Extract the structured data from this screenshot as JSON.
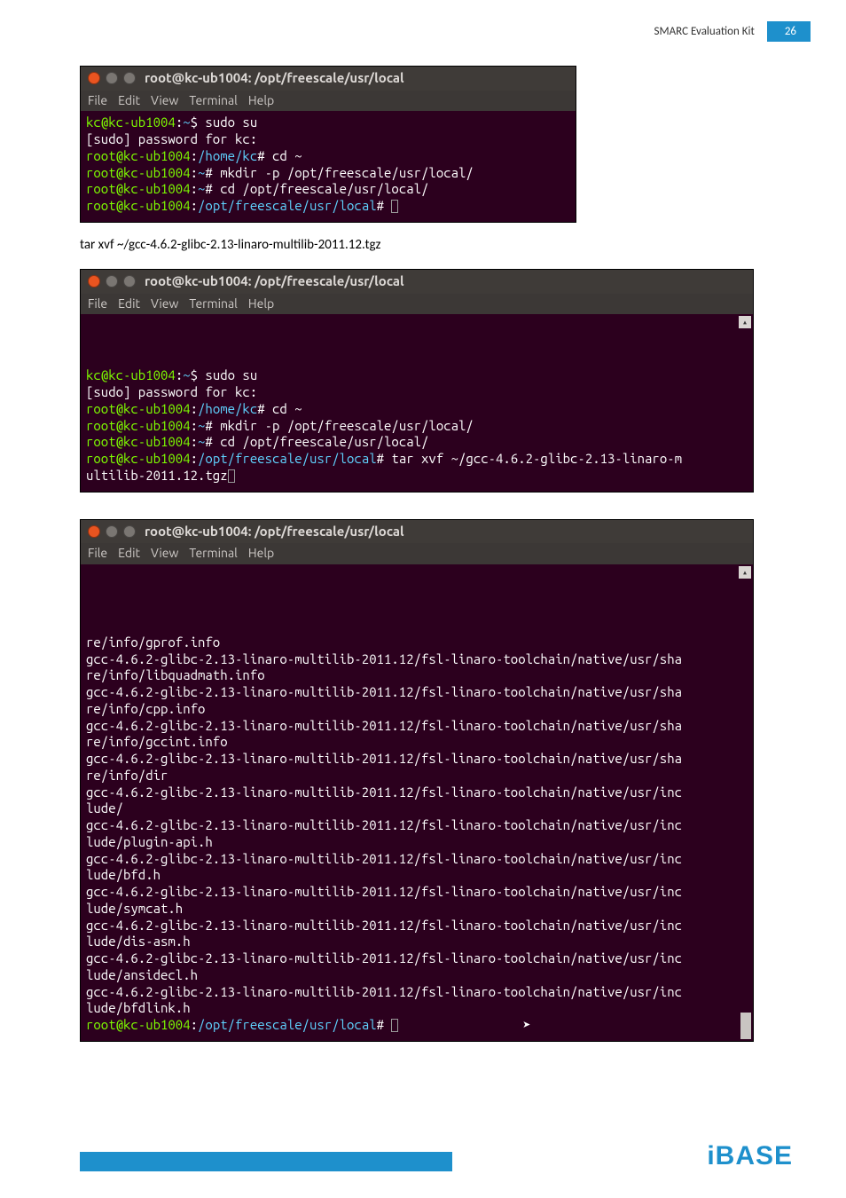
{
  "header": {
    "title": "SMARC  Evaluation  Kit",
    "page_number": "26"
  },
  "body_text_1": "tar xvf ~/gcc-4.6.2-glibc-2.13-linaro-multilib-2011.12.tgz",
  "terminals": {
    "t1": {
      "title": "root@kc-ub1004: /opt/freescale/usr/local",
      "menus": [
        "File",
        "Edit",
        "View",
        "Terminal",
        "Help"
      ],
      "lines": [
        [
          {
            "c": "grn",
            "t": "kc@kc-ub1004"
          },
          {
            "c": "wht",
            "t": ":"
          },
          {
            "c": "blu",
            "t": "~"
          },
          {
            "c": "wht",
            "t": "$ sudo su"
          }
        ],
        [
          {
            "c": "wht",
            "t": "[sudo] password for kc:"
          }
        ],
        [
          {
            "c": "grn",
            "t": "root@kc-ub1004"
          },
          {
            "c": "wht",
            "t": ":"
          },
          {
            "c": "blu",
            "t": "/home/kc"
          },
          {
            "c": "wht",
            "t": "# cd ~"
          }
        ],
        [
          {
            "c": "grn",
            "t": "root@kc-ub1004"
          },
          {
            "c": "wht",
            "t": ":"
          },
          {
            "c": "blu",
            "t": "~"
          },
          {
            "c": "wht",
            "t": "# mkdir -p /opt/freescale/usr/local/"
          }
        ],
        [
          {
            "c": "grn",
            "t": "root@kc-ub1004"
          },
          {
            "c": "wht",
            "t": ":"
          },
          {
            "c": "blu",
            "t": "~"
          },
          {
            "c": "wht",
            "t": "# cd /opt/freescale/usr/local/"
          }
        ],
        [
          {
            "c": "grn",
            "t": "root@kc-ub1004"
          },
          {
            "c": "wht",
            "t": ":"
          },
          {
            "c": "blu",
            "t": "/opt/freescale/usr/local"
          },
          {
            "c": "wht",
            "t": "# "
          },
          {
            "cursor": true
          }
        ]
      ]
    },
    "t2": {
      "title": "root@kc-ub1004: /opt/freescale/usr/local",
      "menus": [
        "File",
        "Edit",
        "View",
        "Terminal",
        "Help"
      ],
      "lines": [
        [
          {
            "c": "grn",
            "t": "kc@kc-ub1004"
          },
          {
            "c": "wht",
            "t": ":"
          },
          {
            "c": "blu",
            "t": "~"
          },
          {
            "c": "wht",
            "t": "$ sudo su"
          }
        ],
        [
          {
            "c": "wht",
            "t": "[sudo] password for kc:"
          }
        ],
        [
          {
            "c": "grn",
            "t": "root@kc-ub1004"
          },
          {
            "c": "wht",
            "t": ":"
          },
          {
            "c": "blu",
            "t": "/home/kc"
          },
          {
            "c": "wht",
            "t": "# cd ~"
          }
        ],
        [
          {
            "c": "grn",
            "t": "root@kc-ub1004"
          },
          {
            "c": "wht",
            "t": ":"
          },
          {
            "c": "blu",
            "t": "~"
          },
          {
            "c": "wht",
            "t": "# mkdir -p /opt/freescale/usr/local/"
          }
        ],
        [
          {
            "c": "grn",
            "t": "root@kc-ub1004"
          },
          {
            "c": "wht",
            "t": ":"
          },
          {
            "c": "blu",
            "t": "~"
          },
          {
            "c": "wht",
            "t": "# cd /opt/freescale/usr/local/"
          }
        ],
        [
          {
            "c": "grn",
            "t": "root@kc-ub1004"
          },
          {
            "c": "wht",
            "t": ":"
          },
          {
            "c": "blu",
            "t": "/opt/freescale/usr/local"
          },
          {
            "c": "wht",
            "t": "# tar xvf ~/gcc-4.6.2-glibc-2.13-linaro-m"
          }
        ],
        [
          {
            "c": "wht",
            "t": "ultilib-2011.12.tgz"
          },
          {
            "cursor": true
          }
        ]
      ]
    },
    "t3": {
      "title": "root@kc-ub1004: /opt/freescale/usr/local",
      "menus": [
        "File",
        "Edit",
        "View",
        "Terminal",
        "Help"
      ],
      "lines": [
        [
          {
            "c": "wht",
            "t": "re/info/gprof.info"
          }
        ],
        [
          {
            "c": "wht",
            "t": "gcc-4.6.2-glibc-2.13-linaro-multilib-2011.12/fsl-linaro-toolchain/native/usr/sha"
          }
        ],
        [
          {
            "c": "wht",
            "t": "re/info/libquadmath.info"
          }
        ],
        [
          {
            "c": "wht",
            "t": "gcc-4.6.2-glibc-2.13-linaro-multilib-2011.12/fsl-linaro-toolchain/native/usr/sha"
          }
        ],
        [
          {
            "c": "wht",
            "t": "re/info/cpp.info"
          }
        ],
        [
          {
            "c": "wht",
            "t": "gcc-4.6.2-glibc-2.13-linaro-multilib-2011.12/fsl-linaro-toolchain/native/usr/sha"
          }
        ],
        [
          {
            "c": "wht",
            "t": "re/info/gccint.info"
          }
        ],
        [
          {
            "c": "wht",
            "t": "gcc-4.6.2-glibc-2.13-linaro-multilib-2011.12/fsl-linaro-toolchain/native/usr/sha"
          }
        ],
        [
          {
            "c": "wht",
            "t": "re/info/dir"
          }
        ],
        [
          {
            "c": "wht",
            "t": "gcc-4.6.2-glibc-2.13-linaro-multilib-2011.12/fsl-linaro-toolchain/native/usr/inc"
          }
        ],
        [
          {
            "c": "wht",
            "t": "lude/"
          }
        ],
        [
          {
            "c": "wht",
            "t": "gcc-4.6.2-glibc-2.13-linaro-multilib-2011.12/fsl-linaro-toolchain/native/usr/inc"
          }
        ],
        [
          {
            "c": "wht",
            "t": "lude/plugin-api.h"
          }
        ],
        [
          {
            "c": "wht",
            "t": "gcc-4.6.2-glibc-2.13-linaro-multilib-2011.12/fsl-linaro-toolchain/native/usr/inc"
          }
        ],
        [
          {
            "c": "wht",
            "t": "lude/bfd.h"
          }
        ],
        [
          {
            "c": "wht",
            "t": "gcc-4.6.2-glibc-2.13-linaro-multilib-2011.12/fsl-linaro-toolchain/native/usr/inc"
          }
        ],
        [
          {
            "c": "wht",
            "t": "lude/symcat.h"
          }
        ],
        [
          {
            "c": "wht",
            "t": "gcc-4.6.2-glibc-2.13-linaro-multilib-2011.12/fsl-linaro-toolchain/native/usr/inc"
          }
        ],
        [
          {
            "c": "wht",
            "t": "lude/dis-asm.h"
          }
        ],
        [
          {
            "c": "wht",
            "t": "gcc-4.6.2-glibc-2.13-linaro-multilib-2011.12/fsl-linaro-toolchain/native/usr/inc"
          }
        ],
        [
          {
            "c": "wht",
            "t": "lude/ansidecl.h"
          }
        ],
        [
          {
            "c": "wht",
            "t": "gcc-4.6.2-glibc-2.13-linaro-multilib-2011.12/fsl-linaro-toolchain/native/usr/inc"
          }
        ],
        [
          {
            "c": "wht",
            "t": "lude/bfdlink.h"
          }
        ],
        [
          {
            "c": "grn",
            "t": "root@kc-ub1004"
          },
          {
            "c": "wht",
            "t": ":"
          },
          {
            "c": "blu",
            "t": "/opt/freescale/usr/local"
          },
          {
            "c": "wht",
            "t": "# "
          },
          {
            "cursor": true
          },
          {
            "pointer": true
          }
        ]
      ]
    }
  },
  "footer_logo": "iBASE"
}
